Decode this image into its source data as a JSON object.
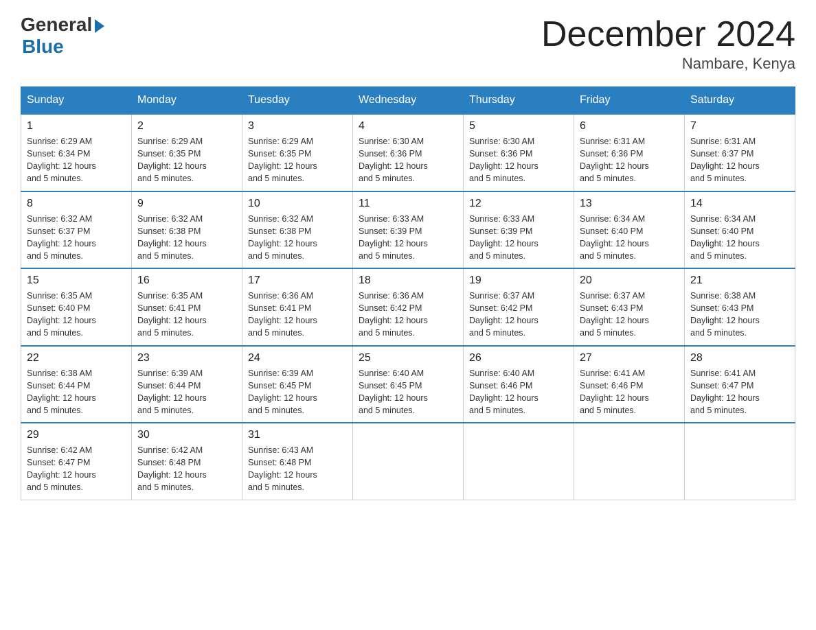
{
  "header": {
    "logo_general": "General",
    "logo_blue": "Blue",
    "month_title": "December 2024",
    "location": "Nambare, Kenya"
  },
  "days_of_week": [
    "Sunday",
    "Monday",
    "Tuesday",
    "Wednesday",
    "Thursday",
    "Friday",
    "Saturday"
  ],
  "weeks": [
    [
      {
        "day": "1",
        "sunrise": "6:29 AM",
        "sunset": "6:34 PM",
        "daylight": "12 hours and 5 minutes."
      },
      {
        "day": "2",
        "sunrise": "6:29 AM",
        "sunset": "6:35 PM",
        "daylight": "12 hours and 5 minutes."
      },
      {
        "day": "3",
        "sunrise": "6:29 AM",
        "sunset": "6:35 PM",
        "daylight": "12 hours and 5 minutes."
      },
      {
        "day": "4",
        "sunrise": "6:30 AM",
        "sunset": "6:36 PM",
        "daylight": "12 hours and 5 minutes."
      },
      {
        "day": "5",
        "sunrise": "6:30 AM",
        "sunset": "6:36 PM",
        "daylight": "12 hours and 5 minutes."
      },
      {
        "day": "6",
        "sunrise": "6:31 AM",
        "sunset": "6:36 PM",
        "daylight": "12 hours and 5 minutes."
      },
      {
        "day": "7",
        "sunrise": "6:31 AM",
        "sunset": "6:37 PM",
        "daylight": "12 hours and 5 minutes."
      }
    ],
    [
      {
        "day": "8",
        "sunrise": "6:32 AM",
        "sunset": "6:37 PM",
        "daylight": "12 hours and 5 minutes."
      },
      {
        "day": "9",
        "sunrise": "6:32 AM",
        "sunset": "6:38 PM",
        "daylight": "12 hours and 5 minutes."
      },
      {
        "day": "10",
        "sunrise": "6:32 AM",
        "sunset": "6:38 PM",
        "daylight": "12 hours and 5 minutes."
      },
      {
        "day": "11",
        "sunrise": "6:33 AM",
        "sunset": "6:39 PM",
        "daylight": "12 hours and 5 minutes."
      },
      {
        "day": "12",
        "sunrise": "6:33 AM",
        "sunset": "6:39 PM",
        "daylight": "12 hours and 5 minutes."
      },
      {
        "day": "13",
        "sunrise": "6:34 AM",
        "sunset": "6:40 PM",
        "daylight": "12 hours and 5 minutes."
      },
      {
        "day": "14",
        "sunrise": "6:34 AM",
        "sunset": "6:40 PM",
        "daylight": "12 hours and 5 minutes."
      }
    ],
    [
      {
        "day": "15",
        "sunrise": "6:35 AM",
        "sunset": "6:40 PM",
        "daylight": "12 hours and 5 minutes."
      },
      {
        "day": "16",
        "sunrise": "6:35 AM",
        "sunset": "6:41 PM",
        "daylight": "12 hours and 5 minutes."
      },
      {
        "day": "17",
        "sunrise": "6:36 AM",
        "sunset": "6:41 PM",
        "daylight": "12 hours and 5 minutes."
      },
      {
        "day": "18",
        "sunrise": "6:36 AM",
        "sunset": "6:42 PM",
        "daylight": "12 hours and 5 minutes."
      },
      {
        "day": "19",
        "sunrise": "6:37 AM",
        "sunset": "6:42 PM",
        "daylight": "12 hours and 5 minutes."
      },
      {
        "day": "20",
        "sunrise": "6:37 AM",
        "sunset": "6:43 PM",
        "daylight": "12 hours and 5 minutes."
      },
      {
        "day": "21",
        "sunrise": "6:38 AM",
        "sunset": "6:43 PM",
        "daylight": "12 hours and 5 minutes."
      }
    ],
    [
      {
        "day": "22",
        "sunrise": "6:38 AM",
        "sunset": "6:44 PM",
        "daylight": "12 hours and 5 minutes."
      },
      {
        "day": "23",
        "sunrise": "6:39 AM",
        "sunset": "6:44 PM",
        "daylight": "12 hours and 5 minutes."
      },
      {
        "day": "24",
        "sunrise": "6:39 AM",
        "sunset": "6:45 PM",
        "daylight": "12 hours and 5 minutes."
      },
      {
        "day": "25",
        "sunrise": "6:40 AM",
        "sunset": "6:45 PM",
        "daylight": "12 hours and 5 minutes."
      },
      {
        "day": "26",
        "sunrise": "6:40 AM",
        "sunset": "6:46 PM",
        "daylight": "12 hours and 5 minutes."
      },
      {
        "day": "27",
        "sunrise": "6:41 AM",
        "sunset": "6:46 PM",
        "daylight": "12 hours and 5 minutes."
      },
      {
        "day": "28",
        "sunrise": "6:41 AM",
        "sunset": "6:47 PM",
        "daylight": "12 hours and 5 minutes."
      }
    ],
    [
      {
        "day": "29",
        "sunrise": "6:42 AM",
        "sunset": "6:47 PM",
        "daylight": "12 hours and 5 minutes."
      },
      {
        "day": "30",
        "sunrise": "6:42 AM",
        "sunset": "6:48 PM",
        "daylight": "12 hours and 5 minutes."
      },
      {
        "day": "31",
        "sunrise": "6:43 AM",
        "sunset": "6:48 PM",
        "daylight": "12 hours and 5 minutes."
      },
      null,
      null,
      null,
      null
    ]
  ]
}
